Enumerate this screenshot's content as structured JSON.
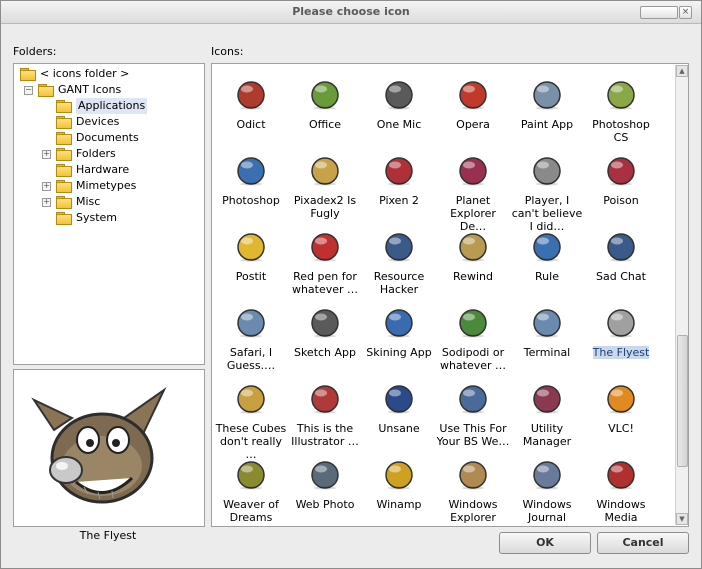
{
  "window": {
    "title": "Please choose icon"
  },
  "folders_label": "Folders:",
  "icons_label": "Icons:",
  "tree": [
    {
      "label": "< icons folder >",
      "expander": "",
      "level": 0
    },
    {
      "label": "GANT Icons",
      "expander": "−",
      "level": 0
    },
    {
      "label": "Applications",
      "expander": "",
      "level": 1,
      "selected": true
    },
    {
      "label": "Devices",
      "expander": "",
      "level": 1
    },
    {
      "label": "Documents",
      "expander": "",
      "level": 1
    },
    {
      "label": "Folders",
      "expander": "+",
      "level": 1
    },
    {
      "label": "Hardware",
      "expander": "",
      "level": 1
    },
    {
      "label": "Mimetypes",
      "expander": "+",
      "level": 1
    },
    {
      "label": "Misc",
      "expander": "+",
      "level": 1
    },
    {
      "label": "System",
      "expander": "",
      "level": 1
    }
  ],
  "preview": {
    "name": "The Flyest"
  },
  "icons": [
    {
      "label": "Odict",
      "color": "#b03a2e"
    },
    {
      "label": "Office",
      "color": "#6a9a3a"
    },
    {
      "label": "One Mic",
      "color": "#5a5a5a"
    },
    {
      "label": "Opera",
      "color": "#c0392b"
    },
    {
      "label": "Paint App",
      "color": "#7a8fa8"
    },
    {
      "label": "Photoshop CS",
      "color": "#8aa84a"
    },
    {
      "label": "Photoshop",
      "color": "#3a6fb0"
    },
    {
      "label": "Pixadex2 Is Fugly",
      "color": "#c8a24a"
    },
    {
      "label": "Pixen 2",
      "color": "#b0303a"
    },
    {
      "label": "Planet Explorer De…",
      "color": "#9a3050"
    },
    {
      "label": "Player, I can't believe I did…",
      "color": "#8a8a8a"
    },
    {
      "label": "Poison",
      "color": "#a83040"
    },
    {
      "label": "Postit",
      "color": "#e0b830"
    },
    {
      "label": "Red pen for whatever …",
      "color": "#c03030"
    },
    {
      "label": "Resource Hacker",
      "color": "#3a5a8a"
    },
    {
      "label": "Rewind",
      "color": "#b89a50"
    },
    {
      "label": "Rule",
      "color": "#3a70b0"
    },
    {
      "label": "Sad Chat",
      "color": "#3a5a8a"
    },
    {
      "label": "Safari, I Guess.…",
      "color": "#6a8ab0"
    },
    {
      "label": "Sketch App",
      "color": "#5a5a5a"
    },
    {
      "label": "Skining App",
      "color": "#3a6ab0"
    },
    {
      "label": "Sodipodi or whatever …",
      "color": "#4a8a3a"
    },
    {
      "label": "Terminal",
      "color": "#6a8ab0"
    },
    {
      "label": "The Flyest",
      "color": "#a0a0a0",
      "selected": true
    },
    {
      "label": "These Cubes don't really …",
      "color": "#c8a040"
    },
    {
      "label": "This is the Illustrator …",
      "color": "#b03a3a"
    },
    {
      "label": "Unsane",
      "color": "#2a4a8a"
    },
    {
      "label": "Use This For Your BS We…",
      "color": "#4a6a9a"
    },
    {
      "label": "Utility Manager",
      "color": "#8a3a50"
    },
    {
      "label": "VLC!",
      "color": "#e08a20"
    },
    {
      "label": "Weaver of Dreams",
      "color": "#8a8a30"
    },
    {
      "label": "Web Photo",
      "color": "#5a6a7a"
    },
    {
      "label": "Winamp",
      "color": "#d0a020"
    },
    {
      "label": "Windows Explorer",
      "color": "#b08a50"
    },
    {
      "label": "Windows Journal Viewer",
      "color": "#6a7a9a"
    },
    {
      "label": "Windows Media",
      "color": "#b03030"
    }
  ],
  "buttons": {
    "ok": "OK",
    "cancel": "Cancel"
  }
}
